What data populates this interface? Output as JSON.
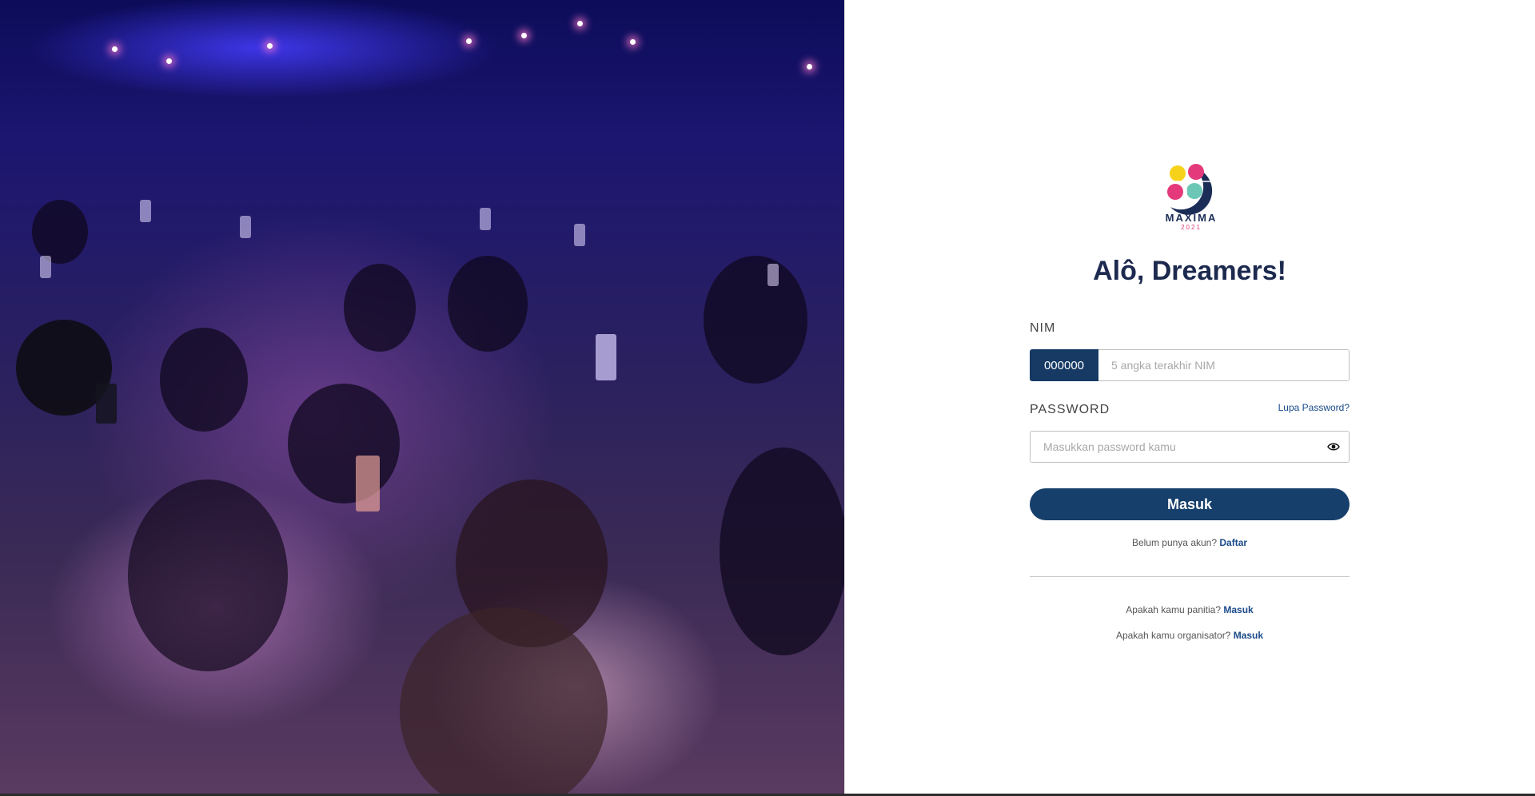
{
  "brand": {
    "name": "MAXIMA",
    "year": "2021",
    "colors": {
      "yellow": "#f7d21b",
      "pink": "#e43a7b",
      "teal": "#6cc7b6",
      "navy": "#1b2d57"
    }
  },
  "hero": {
    "image": "concert-crowd-photo"
  },
  "login": {
    "title": "Alô, Dreamers!",
    "nim_label": "NIM",
    "nim_prefix": "000000",
    "nim_placeholder": "5 angka terakhir NIM",
    "password_label": "PASSWORD",
    "forgot_password": "Lupa Password?",
    "password_placeholder": "Masukkan password kamu",
    "submit_label": "Masuk",
    "signup_text": "Belum punya akun?",
    "signup_link": "Daftar",
    "panitia_text": "Apakah kamu panitia?",
    "panitia_link": "Masuk",
    "organisator_text": "Apakah kamu organisator?",
    "organisator_link": "Masuk"
  },
  "theme": {
    "primary": "#173f6b",
    "link": "#1a4a8a"
  }
}
